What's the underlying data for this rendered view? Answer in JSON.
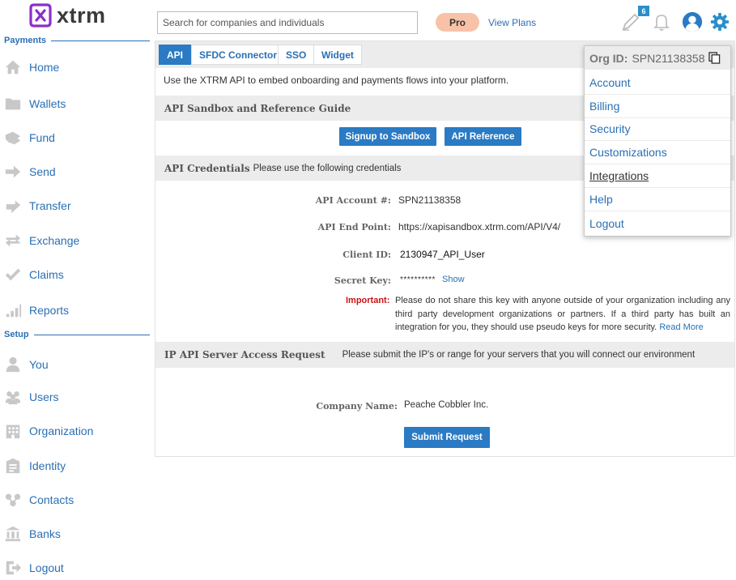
{
  "brand": {
    "name": "xtrm",
    "accent": "#8b2fc9",
    "link_color": "#2a6fb5",
    "button_color": "#2a7ac4"
  },
  "sidebar": {
    "payments_header": "Payments",
    "payments": [
      {
        "label": "Home",
        "icon": "home-icon"
      },
      {
        "label": "Wallets",
        "icon": "folder-icon"
      },
      {
        "label": "Fund",
        "icon": "fund-icon"
      },
      {
        "label": "Send",
        "icon": "send-arrow-icon"
      },
      {
        "label": "Transfer",
        "icon": "transfer-icon"
      },
      {
        "label": "Exchange",
        "icon": "exchange-icon"
      },
      {
        "label": "Claims",
        "icon": "check-icon"
      },
      {
        "label": "Reports",
        "icon": "bar-chart-icon"
      }
    ],
    "setup_header": "Setup",
    "setup": [
      {
        "label": "You",
        "icon": "person-icon"
      },
      {
        "label": "Users",
        "icon": "users-icon"
      },
      {
        "label": "Organization",
        "icon": "building-icon"
      },
      {
        "label": "Identity",
        "icon": "identity-icon"
      },
      {
        "label": "Contacts",
        "icon": "contacts-icon"
      },
      {
        "label": "Banks",
        "icon": "bank-icon"
      },
      {
        "label": "Logout",
        "icon": "logout-icon"
      }
    ]
  },
  "header": {
    "search_placeholder": "Search for companies and individuals",
    "plan_badge": "Pro",
    "view_plans": "View Plans",
    "notification_count": "6"
  },
  "tabs": [
    "API",
    "SFDC Connector",
    "SSO",
    "Widget"
  ],
  "intro": "Use the XTRM API to embed onboarding and payments flows into your platform.",
  "sandbox": {
    "title": "API Sandbox and Reference Guide",
    "signup_button": "Signup to Sandbox",
    "reference_button": "API Reference"
  },
  "credentials": {
    "title": "API Credentials",
    "subtitle": "Please use the following credentials",
    "account_label": "API Account #:",
    "account_value": "SPN21138358",
    "endpoint_label": "API End Point:",
    "endpoint_value": "https://xapisandbox.xtrm.com/API/V4/",
    "client_label": "Client ID:",
    "client_value": "2130947_API_User",
    "secret_label": "Secret Key:",
    "secret_value": "**********",
    "show_link": "Show",
    "important_label": "Important:",
    "important_text": "Please do not share this key with anyone outside of your organization including any third party development organizations or partners. If a third party has built an integration for you, they should use pseudo keys for more security.",
    "read_more": "Read More"
  },
  "ip_request": {
    "title": "IP API Server Access Request",
    "subtitle": "Please submit the IP's or range for your servers that you will connect our environment",
    "company_label": "Company Name:",
    "company_value": "Peache Cobbler Inc.",
    "submit_button": "Submit Request"
  },
  "dropdown": {
    "org_label": "Org ID:",
    "org_value": "SPN21138358",
    "items": [
      "Account",
      "Billing",
      "Security",
      "Customizations",
      "Integrations",
      "Help",
      "Logout"
    ]
  }
}
